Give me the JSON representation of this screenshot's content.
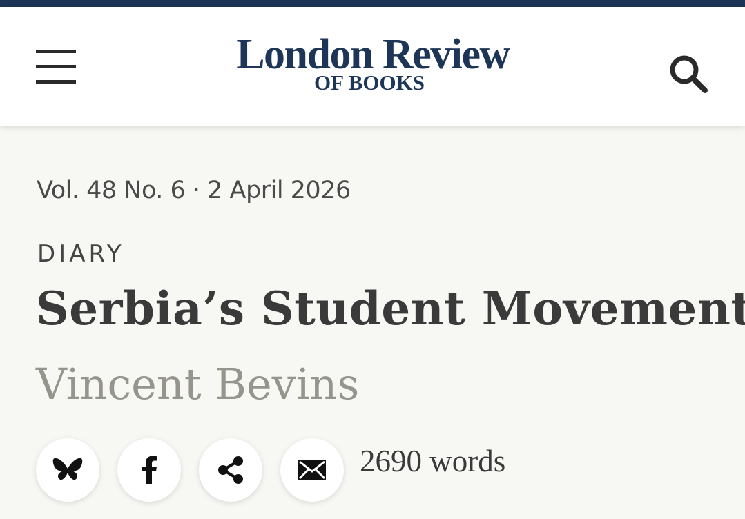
{
  "header": {
    "logo_main": "London Review",
    "logo_sub": "OF BOOKS",
    "menu_icon": "hamburger-menu-icon",
    "search_icon": "search-icon",
    "brand_color": "#1d3557"
  },
  "article": {
    "issue_meta": "Vol. 48 No. 6 · 2 April 2026",
    "category": "DIARY",
    "title": "Serbia’s Student Movement",
    "author": "Vincent Bevins",
    "word_count": "2690 words"
  },
  "share": {
    "buttons": [
      {
        "icon": "bluesky-icon"
      },
      {
        "icon": "facebook-icon"
      },
      {
        "icon": "share-icon"
      },
      {
        "icon": "email-icon"
      }
    ]
  }
}
